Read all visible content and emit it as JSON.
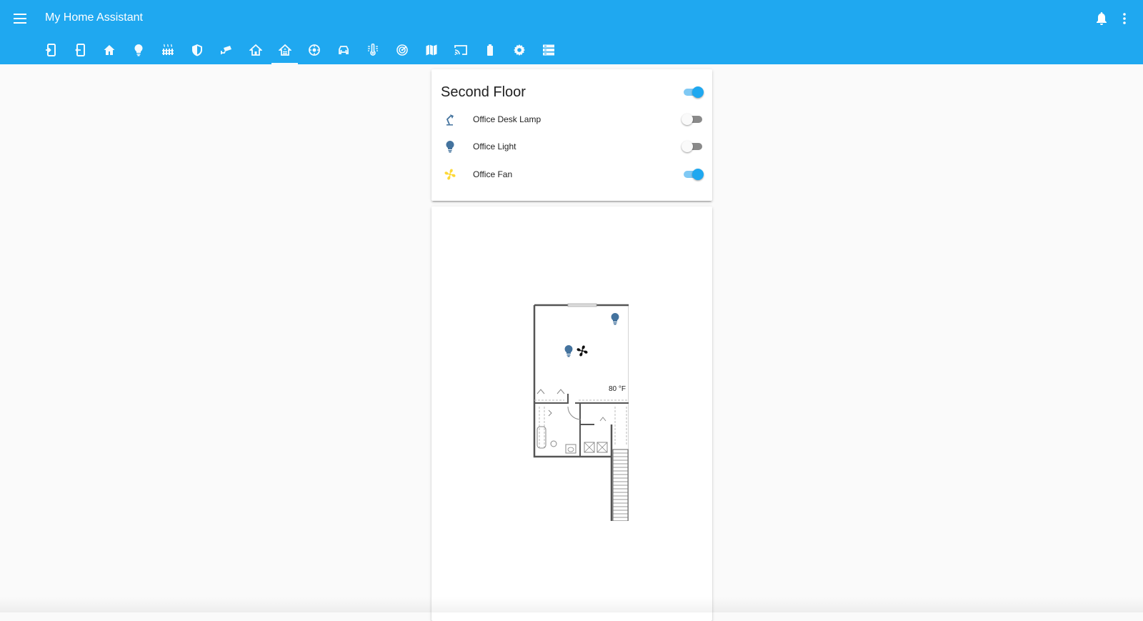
{
  "app": {
    "title": "My Home Assistant"
  },
  "header": {
    "menu_icon": "menu-icon",
    "right_icons": [
      "bell-icon",
      "dots-vertical-icon"
    ]
  },
  "tabs": [
    {
      "icon": "tablet-login-icon",
      "active": false
    },
    {
      "icon": "tablet-exit-icon",
      "active": false
    },
    {
      "icon": "home-icon",
      "active": false
    },
    {
      "icon": "lightbulb-icon",
      "active": false
    },
    {
      "icon": "radiator-icon",
      "active": false
    },
    {
      "icon": "shield-icon",
      "active": false
    },
    {
      "icon": "cctv-icon",
      "active": false
    },
    {
      "icon": "home-outline-icon",
      "active": false
    },
    {
      "icon": "home-floor-icon",
      "active": true
    },
    {
      "icon": "robot-vacuum-icon",
      "active": false
    },
    {
      "icon": "car-icon",
      "active": false
    },
    {
      "icon": "thermometer-lines-icon",
      "active": false
    },
    {
      "icon": "radar-icon",
      "active": false
    },
    {
      "icon": "map-icon",
      "active": false
    },
    {
      "icon": "cast-icon",
      "active": false
    },
    {
      "icon": "battery-icon",
      "active": false
    },
    {
      "icon": "gear-icon",
      "active": false
    },
    {
      "icon": "server-icon",
      "active": false
    }
  ],
  "entities_card": {
    "title": "Second Floor",
    "header_toggle_on": true,
    "entities": [
      {
        "name": "Office Desk Lamp",
        "icon": "desk-lamp-icon",
        "state_on": false
      },
      {
        "name": "Office Light",
        "icon": "lightbulb-icon",
        "state_on": false
      },
      {
        "name": "Office Fan",
        "icon": "fan-icon",
        "state_on": true
      }
    ]
  },
  "floorplan": {
    "temperature": "80 °F"
  },
  "colors": {
    "primary": "#1fa8f0",
    "icon_off": "#44739e",
    "icon_on": "#fdd835"
  }
}
